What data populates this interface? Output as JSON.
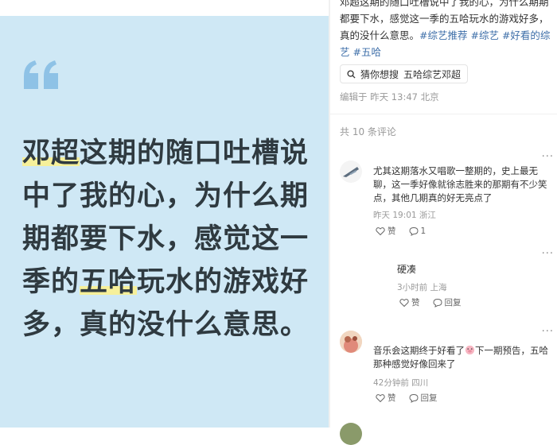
{
  "image_card": {
    "big_text": {
      "p1": "邓超",
      "p2": "这期的随口吐槽说中了我的心，为什么期期都要下水，感觉这一季的",
      "p3": "五哈",
      "p4": "玩水的游戏好多，真的没什么意思。"
    }
  },
  "post": {
    "text": "邓超这期的随口吐槽说中了我的心，为什么期期都要下水，感觉这一季的五哈玩水的游戏好多，真的没什么意思。",
    "tags": [
      "#综艺推荐",
      "#综艺",
      "#好看的综艺",
      "#五哈"
    ],
    "search_chip": {
      "label": "猜你想搜",
      "query": "五哈综艺邓超"
    },
    "edited": "编辑于 昨天 13:47 北京"
  },
  "comments_header": "共 10 条评论",
  "comments": [
    {
      "text": "尤其这期落水又唱歌一整期的，史上最无聊，这一季好像就徐志胜来的那期有不少笑点，其他几期真的好无亮点了",
      "meta": "昨天 19:01 浙江",
      "like_label": "赞",
      "reply_count": "1",
      "more": "···"
    },
    {
      "text": "硬凑",
      "meta": "3小时前 上海",
      "like_label": "赞",
      "reply_label": "回复",
      "more": "···"
    },
    {
      "text_a": "音乐会这期终于好看了",
      "text_b": "下一期预告，五哈那种感觉好像回来了",
      "meta": "42分钟前 四川",
      "like_label": "赞",
      "reply_label": "回复",
      "more": "···"
    }
  ],
  "colors": {
    "card_bg": "#cfe8f5",
    "quote": "#8ec2e6",
    "highlight": "#f6f09a",
    "tag": "#3d6ea8"
  }
}
